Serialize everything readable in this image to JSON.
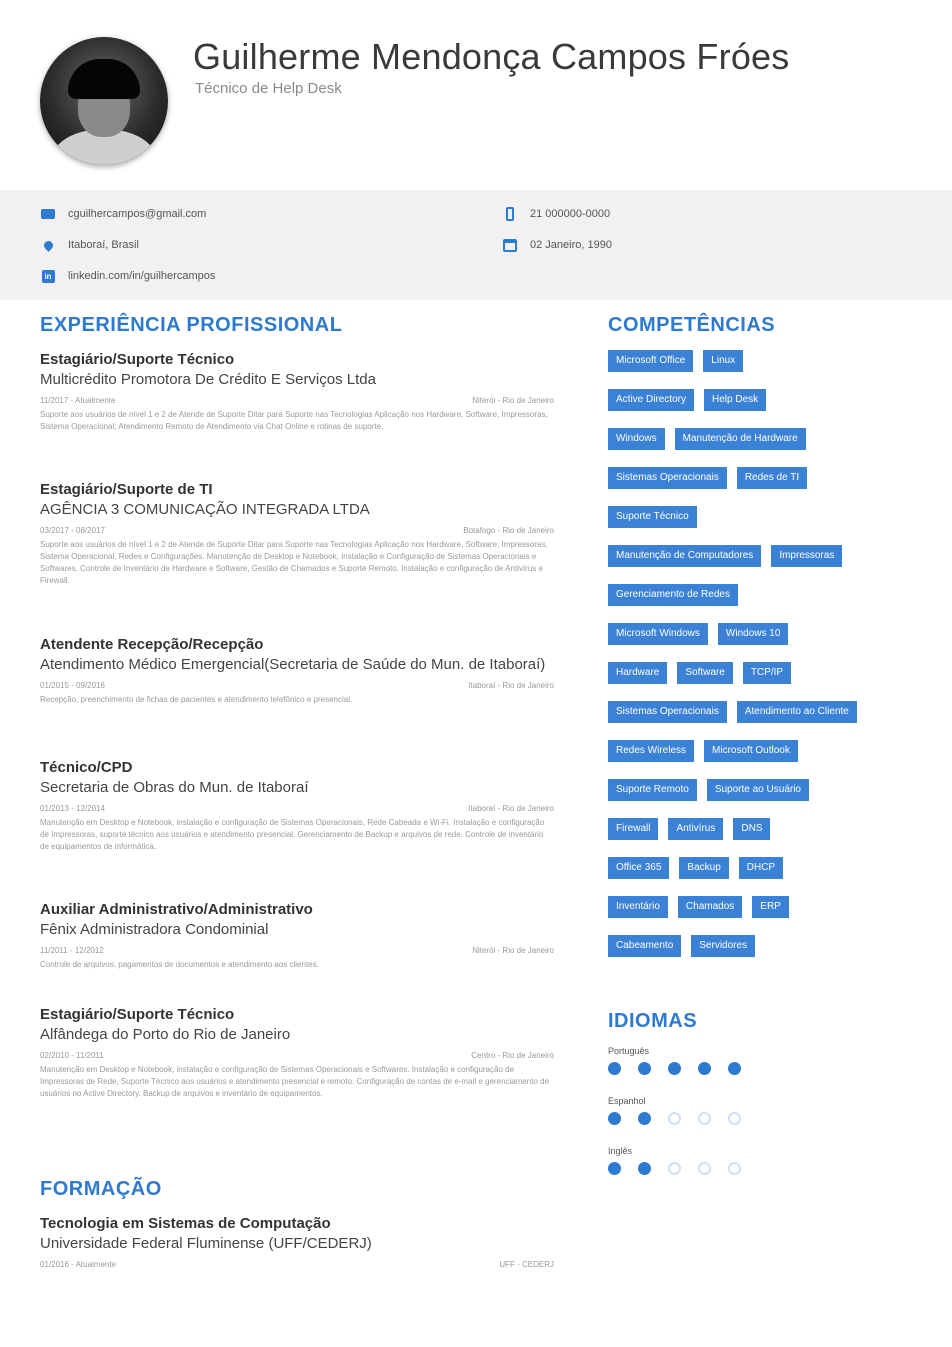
{
  "header": {
    "name": "Guilherme Mendonça Campos Fróes",
    "role": "Técnico de Help Desk"
  },
  "contact": {
    "email": "cguilhercampos@gmail.com",
    "location": "Itaboraí, Brasil",
    "linkedin": "linkedin.com/in/guilhercampos",
    "phone": "21 000000-0000",
    "birthdate": "02 Janeiro, 1990"
  },
  "sections": {
    "experience": "EXPERIÊNCIA PROFISSIONAL",
    "education": "FORMAÇÃO",
    "skills": "COMPETÊNCIAS",
    "languages": "IDIOMAS"
  },
  "experience": [
    {
      "title": "Estagiário/Suporte Técnico",
      "company": "Multicrédito Promotora De Crédito E Serviços Ltda",
      "dates": "11/2017 - Atualmente",
      "place": "Niterói - Rio de Janeiro",
      "desc": "Suporte aos usuários de nível 1 e 2 de Atende de Suporte Ditar para Suporte nas Tecnologias Aplicação nos Hardware, Software, Impressoras, Sistema Operacional; Atendimento Remoto de Atendimento via Chat Online e rotinas de suporte."
    },
    {
      "title": "Estagiário/Suporte de TI",
      "company": "AGÊNCIA 3 COMUNICAÇÃO INTEGRADA LTDA",
      "dates": "03/2017 - 08/2017",
      "place": "Botafogo - Rio de Janeiro",
      "desc": "Suporte aos usuários de nível 1 e 2 de Atende de Suporte Ditar para Suporte nas Tecnologias Aplicação nos Hardware, Software, Impressoras, Sistema Operacional, Redes e Configurações. Manutenção de Desktop e Notebook, Instalação e Configuração de Sistemas Operacionais e Softwares. Controle de Inventário de Hardware e Software, Gestão de Chamados e Suporte Remoto. Instalação e configuração de Antivírus e Firewall."
    },
    {
      "title": "Atendente Recepção/Recepção",
      "company": "Atendimento Médico Emergencial(Secretaria de Saúde do Mun. de Itaboraí)",
      "dates": "01/2015 - 09/2016",
      "place": "Itaboraí - Rio de Janeiro",
      "desc": "Recepção, preenchimento de fichas de pacientes e atendimento telefônico e presencial."
    },
    {
      "title": "Técnico/CPD",
      "company": "Secretaria de Obras do Mun. de Itaboraí",
      "dates": "01/2013 - 12/2014",
      "place": "Itaboraí - Rio de Janeiro",
      "desc": "Manutenção em Desktop e Notebook, instalação e configuração de Sistemas Operacionais, Rede Cabeada e Wi-Fi. Instalação e configuração de Impressoras, suporte técnico aos usuários e atendimento presencial. Gerenciamento de Backup e arquivos de rede. Controle de inventário de equipamentos de informática."
    },
    {
      "title": "Auxiliar Administrativo/Administrativo",
      "company": "Fênix Administradora Condominial",
      "dates": "11/2011 - 12/2012",
      "place": "Niterói - Rio de Janeiro",
      "desc": "Controle de arquivos, pagamentos de documentos e atendimento aos clientes."
    },
    {
      "title": "Estagiário/Suporte Técnico",
      "company": "Alfândega do Porto do Rio de Janeiro",
      "dates": "02/2010 - 11/2011",
      "place": "Centro - Rio de Janeiro",
      "desc": "Manutenção em Desktop e Notebook, instalação e configuração de Sistemas Operacionais e Softwares. Instalação e configuração de Impressoras de Rede, Suporte Técnico aos usuários e atendimento presencial e remoto. Configuração de contas de e-mail e gerenciamento de usuários no Active Directory. Backup de arquivos e inventário de equipamentos."
    }
  ],
  "education": [
    {
      "title": "Tecnologia em Sistemas de Computação",
      "school": "Universidade Federal Fluminense (UFF/CEDERJ)",
      "dates": "01/2016 - Atualmente",
      "place": "UFF - CEDERJ"
    }
  ],
  "skills": [
    [
      "Microsoft Office",
      "Linux"
    ],
    [
      "Active Directory",
      "Help Desk"
    ],
    [
      "Windows",
      "Manutenção de Hardware"
    ],
    [
      "Sistemas Operacionais",
      "Redes de TI"
    ],
    [
      "Suporte Técnico"
    ],
    [
      "Manutenção de Computadores",
      "Impressoras"
    ],
    [
      "Gerenciamento de Redes"
    ],
    [
      "Microsoft Windows",
      "Windows 10"
    ],
    [
      "Hardware",
      "Software",
      "TCP/IP"
    ],
    [
      "Sistemas Operacionais",
      "Atendimento ao Cliente"
    ],
    [
      "Redes Wireless",
      "Microsoft Outlook"
    ],
    [
      "Suporte Remoto",
      "Suporte ao Usuário"
    ],
    [
      "Firewall",
      "Antivírus",
      "DNS"
    ],
    [
      "Office 365",
      "Backup",
      "DHCP"
    ],
    [
      "Inventário",
      "Chamados",
      "ERP"
    ],
    [
      "Cabeamento",
      "Servidores"
    ]
  ],
  "languages": [
    {
      "name": "Português",
      "level": 5,
      "max": 5
    },
    {
      "name": "Espanhol",
      "level": 2,
      "max": 5
    },
    {
      "name": "Inglês",
      "level": 2,
      "max": 5
    }
  ]
}
